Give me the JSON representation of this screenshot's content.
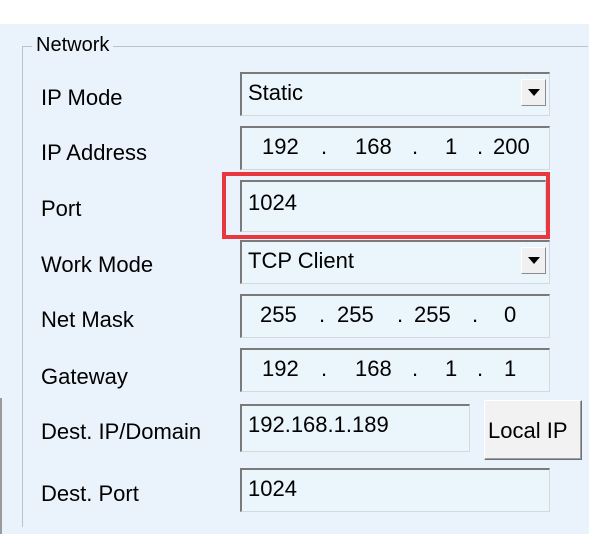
{
  "group": {
    "title": "Network"
  },
  "labels": {
    "ip_mode": "IP Mode",
    "ip_address": "IP Address",
    "port": "Port",
    "work_mode": "Work Mode",
    "net_mask": "Net Mask",
    "gateway": "Gateway",
    "dest_ip": "Dest. IP/Domain",
    "dest_port": "Dest. Port"
  },
  "fields": {
    "ip_mode": "Static",
    "ip_address": [
      "192",
      "168",
      "1",
      "200"
    ],
    "port": "1024",
    "work_mode": "TCP Client",
    "net_mask": [
      "255",
      "255",
      "255",
      "0"
    ],
    "gateway": [
      "192",
      "168",
      "1",
      "1"
    ],
    "dest_ip": "192.168.1.189",
    "dest_port": "1024"
  },
  "ip_separator": ".",
  "buttons": {
    "local_ip": "Local IP"
  },
  "icons": {
    "dropdown": "chevron-down-icon"
  },
  "colors": {
    "highlight": "#e8373f",
    "background": "#eaf3fb",
    "field_bg": "#eaf5fc"
  }
}
